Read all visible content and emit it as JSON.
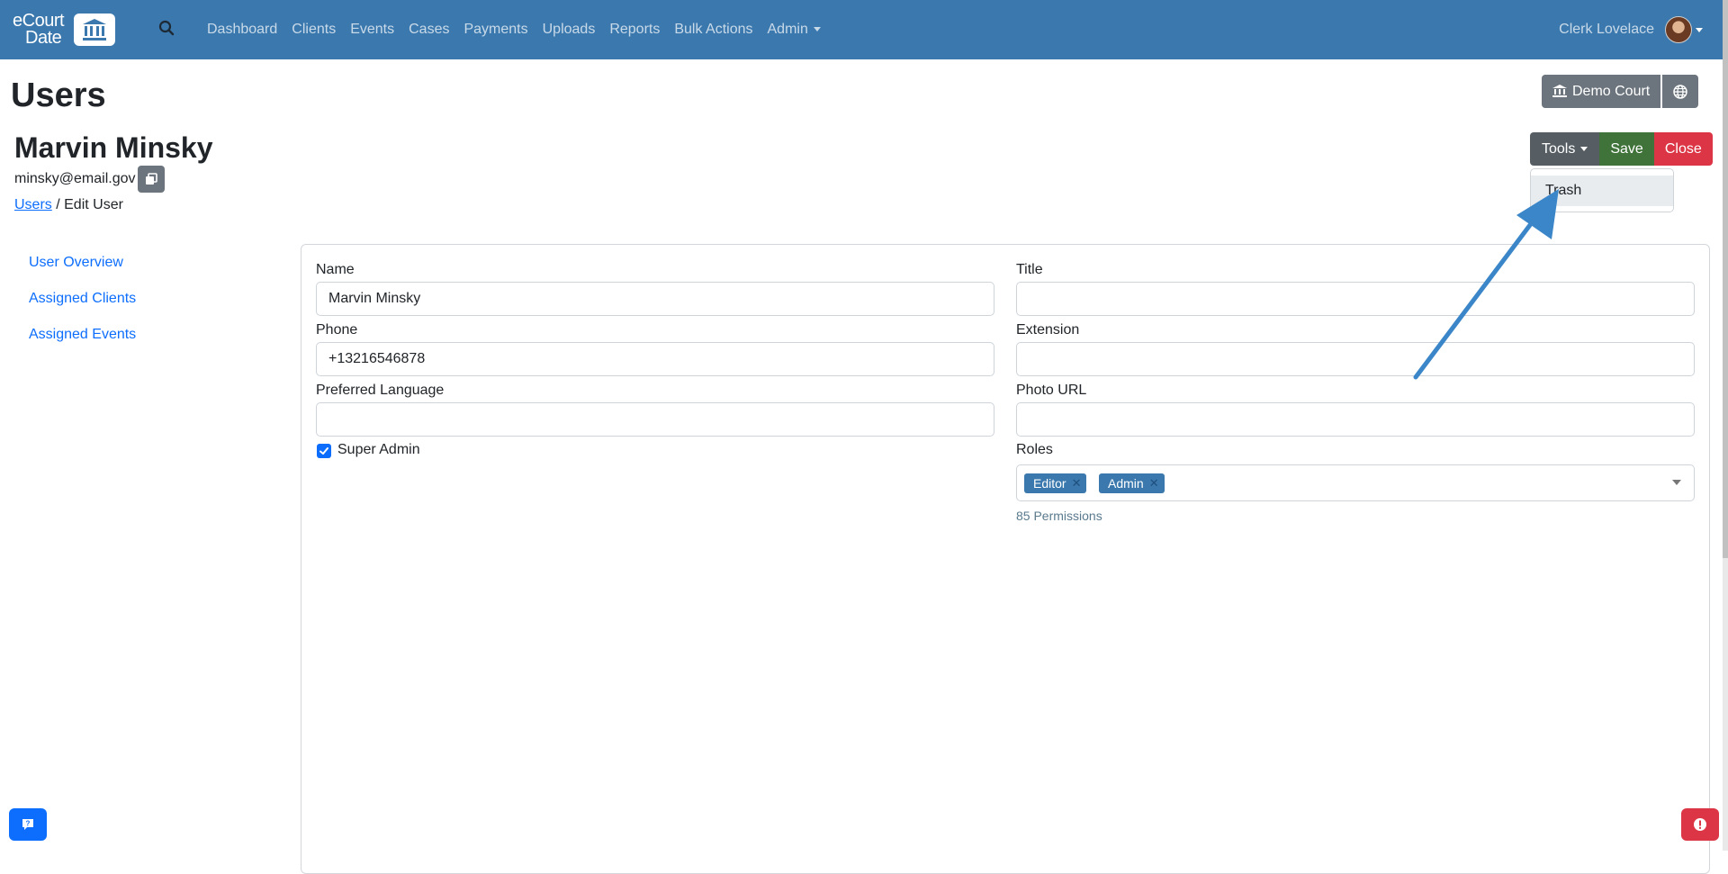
{
  "brand": {
    "line1": "eCourt",
    "line2": "Date"
  },
  "nav": {
    "links": [
      "Dashboard",
      "Clients",
      "Events",
      "Cases",
      "Payments",
      "Uploads",
      "Reports",
      "Bulk Actions",
      "Admin"
    ],
    "user_name": "Clerk Lovelace"
  },
  "page": {
    "title": "Users"
  },
  "court": {
    "label": "Demo Court"
  },
  "user": {
    "name": "Marvin Minsky",
    "email": "minsky@email.gov"
  },
  "breadcrumb": {
    "link": "Users",
    "separator": " / ",
    "current": "Edit User"
  },
  "toolbar": {
    "tools_label": "Tools",
    "save_label": "Save",
    "close_label": "Close"
  },
  "tools_menu": {
    "items": [
      "Trash"
    ]
  },
  "side_nav": {
    "items": [
      "User Overview",
      "Assigned Clients",
      "Assigned Events"
    ]
  },
  "form": {
    "name": {
      "label": "Name",
      "value": "Marvin Minsky"
    },
    "title": {
      "label": "Title",
      "value": ""
    },
    "phone": {
      "label": "Phone",
      "value": "+13216546878"
    },
    "extension": {
      "label": "Extension",
      "value": ""
    },
    "language": {
      "label": "Preferred Language",
      "value": ""
    },
    "photo_url": {
      "label": "Photo URL",
      "value": ""
    },
    "super_admin": {
      "label": "Super Admin",
      "checked": true
    },
    "roles": {
      "label": "Roles",
      "tags": [
        "Editor",
        "Admin"
      ],
      "permissions_text": "85 Permissions"
    }
  },
  "colors": {
    "navbar": "#3a78ae",
    "primary": "#0d6efd",
    "success": "#3f7339",
    "danger": "#dc3545",
    "secondary": "#6c757d",
    "annotation_arrow": "#3a86c8"
  },
  "icons": [
    "bank-icon",
    "search-icon",
    "globe-icon",
    "copy-icon",
    "check-icon",
    "help-chat-icon",
    "alert-icon"
  ]
}
